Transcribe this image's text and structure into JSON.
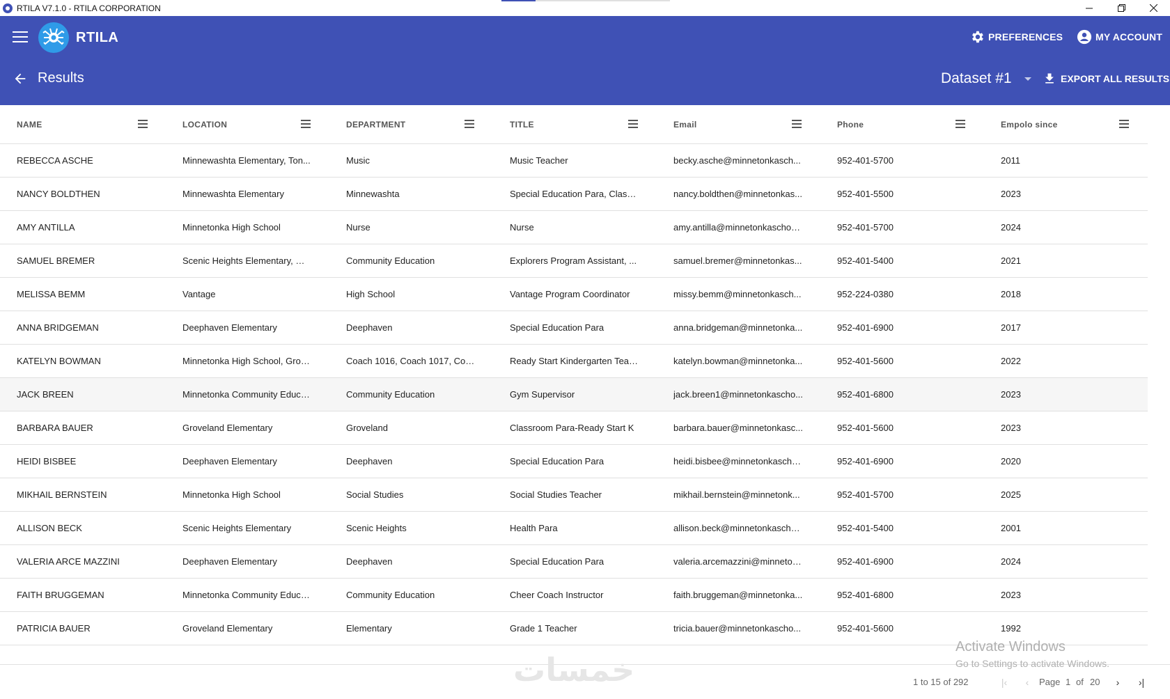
{
  "window": {
    "title": "RTILA V7.1.0 - RTILA CORPORATION",
    "loading_progress": 0.2,
    "minimize_icon": "minimize-icon",
    "restore_icon": "restore-icon",
    "close_icon": "close-icon"
  },
  "header": {
    "brand": "RTILA",
    "preferences_label": "PREFERENCES",
    "account_label": "MY ACCOUNT",
    "page_title": "Results",
    "dataset": "Dataset #1",
    "export_label": "EXPORT ALL RESULTS",
    "accent_color": "#3f51b5"
  },
  "table": {
    "columns": [
      "NAME",
      "LOCATION",
      "DEPARTMENT",
      "TITLE",
      "Email",
      "Phone",
      "Empolo since"
    ],
    "rows": [
      [
        "REBECCA ASCHE",
        "Minnewashta Elementary, Ton...",
        "Music",
        "Music Teacher",
        "becky.asche@minnetonkasch...",
        "952-401-5700",
        "2011"
      ],
      [
        "NANCY BOLDTHEN",
        "Minnewashta Elementary",
        "Minnewashta",
        "Special Education Para, Classr...",
        "nancy.boldthen@minnetonkas...",
        "952-401-5500",
        "2023"
      ],
      [
        "AMY ANTILLA",
        "Minnetonka High School",
        "Nurse",
        "Nurse",
        "amy.antilla@minnetonkaschoo...",
        "952-401-5700",
        "2024"
      ],
      [
        "SAMUEL BREMER",
        "Scenic Heights Elementary, Mi...",
        "Community Education",
        "Explorers Program Assistant, ...",
        "samuel.bremer@minnetonkas...",
        "952-401-5400",
        "2021"
      ],
      [
        "MELISSA BEMM",
        "Vantage",
        "High School",
        "Vantage Program Coordinator",
        "missy.bemm@minnetonkasch...",
        "952-224-0380",
        "2018"
      ],
      [
        "ANNA BRIDGEMAN",
        "Deephaven Elementary",
        "Deephaven",
        "Special Education Para",
        "anna.bridgeman@minnetonka...",
        "952-401-6900",
        "2017"
      ],
      [
        "KATELYN BOWMAN",
        "Minnetonka High School, Grov...",
        "Coach 1016, Coach 1017, Coa...",
        "Ready Start Kindergarten Teac...",
        "katelyn.bowman@minnetonka...",
        "952-401-5600",
        "2022"
      ],
      [
        "JACK BREEN",
        "Minnetonka Community Educa...",
        "Community Education",
        "Gym Supervisor",
        "jack.breen1@minnetonkascho...",
        "952-401-6800",
        "2023"
      ],
      [
        "BARBARA BAUER",
        "Groveland Elementary",
        "Groveland",
        "Classroom Para-Ready Start K",
        "barbara.bauer@minnetonkasc...",
        "952-401-5600",
        "2023"
      ],
      [
        "HEIDI BISBEE",
        "Deephaven Elementary",
        "Deephaven",
        "Special Education Para",
        "heidi.bisbee@minnetonkascho...",
        "952-401-6900",
        "2020"
      ],
      [
        "MIKHAIL BERNSTEIN",
        "Minnetonka High School",
        "Social Studies",
        "Social Studies Teacher",
        "mikhail.bernstein@minnetonk...",
        "952-401-5700",
        "2025"
      ],
      [
        "ALLISON BECK",
        "Scenic Heights Elementary",
        "Scenic Heights",
        "Health Para",
        "allison.beck@minnetonkascho...",
        "952-401-5400",
        "2001"
      ],
      [
        "VALERIA ARCE MAZZINI",
        "Deephaven Elementary",
        "Deephaven",
        "Special Education Para",
        "valeria.arcemazzini@minneton...",
        "952-401-6900",
        "2024"
      ],
      [
        "FAITH BRUGGEMAN",
        "Minnetonka Community Educa...",
        "Community Education",
        "Cheer Coach Instructor",
        "faith.bruggeman@minnetonka...",
        "952-401-6800",
        "2023"
      ],
      [
        "PATRICIA BAUER",
        "Groveland Elementary",
        "Elementary",
        "Grade 1 Teacher",
        "tricia.bauer@minnetonkascho...",
        "952-401-5600",
        "1992"
      ]
    ]
  },
  "pagination": {
    "range": "1 to 15 of 292",
    "page_label": "Page",
    "page": "1",
    "of_label": "of",
    "total_pages": "20"
  },
  "watermark": {
    "line1": "Activate Windows",
    "line2": "Go to Settings to activate Windows.",
    "logo_text": "خمسات"
  }
}
